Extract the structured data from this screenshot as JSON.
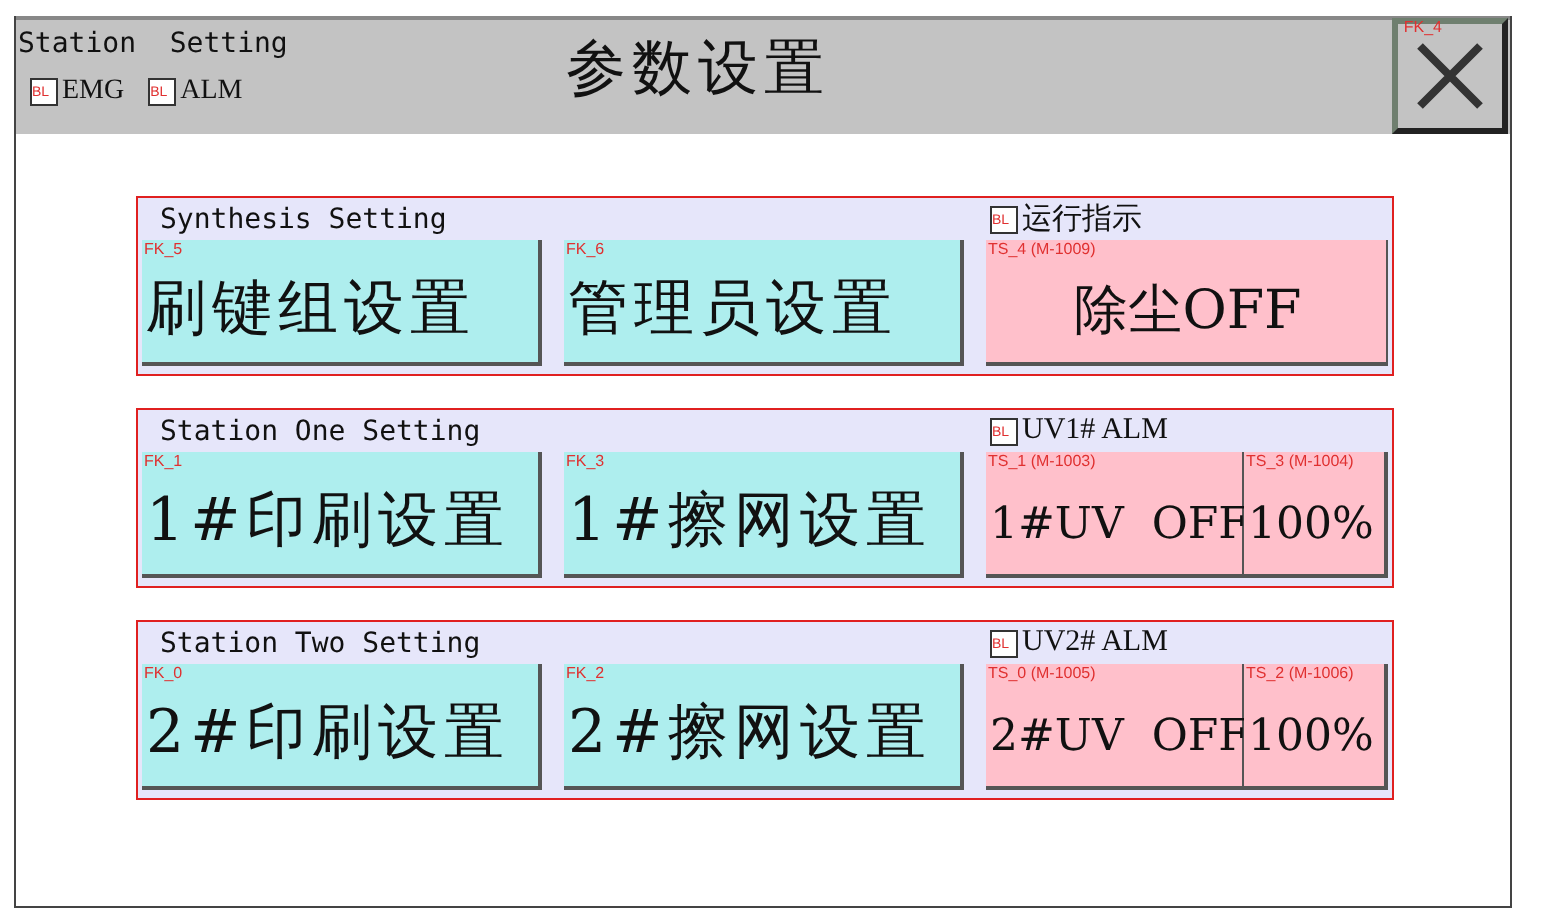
{
  "header": {
    "caption": "Station  Setting",
    "indicators": [
      {
        "tag": "BL",
        "label": "EMG"
      },
      {
        "tag": "BL",
        "label": "ALM"
      }
    ],
    "title": "参数设置",
    "close": {
      "tag": "FK_4"
    }
  },
  "groups": [
    {
      "title": "Synthesis Setting",
      "indicator": {
        "tag": "BL",
        "label": "运行指示"
      },
      "buttons": [
        {
          "kind": "function",
          "tag": "FK_5",
          "label": "刷键组设置"
        },
        {
          "kind": "function",
          "tag": "FK_6",
          "label": "管理员设置"
        },
        {
          "kind": "toggle",
          "tag": "TS_4 (M-1009)",
          "label": "除尘OFF"
        }
      ]
    },
    {
      "title": "Station One Setting",
      "indicator": {
        "tag": "BL",
        "label": "UV1# ALM"
      },
      "buttons": [
        {
          "kind": "function",
          "tag": "FK_1",
          "label": "1#印刷设置"
        },
        {
          "kind": "function",
          "tag": "FK_3",
          "label": "1#擦网设置"
        },
        {
          "kind": "toggle",
          "tag": "TS_1 (M-1003)",
          "label": "1#UV  OFF"
        },
        {
          "kind": "value",
          "tag": "TS_3 (M-1004)",
          "label": "100%"
        }
      ]
    },
    {
      "title": "Station Two Setting",
      "indicator": {
        "tag": "BL",
        "label": "UV2# ALM"
      },
      "buttons": [
        {
          "kind": "function",
          "tag": "FK_0",
          "label": "2#印刷设置"
        },
        {
          "kind": "function",
          "tag": "FK_2",
          "label": "2#擦网设置"
        },
        {
          "kind": "toggle",
          "tag": "TS_0 (M-1005)",
          "label": "2#UV  OFF"
        },
        {
          "kind": "value",
          "tag": "TS_2 (M-1006)",
          "label": "100%"
        }
      ]
    }
  ]
}
